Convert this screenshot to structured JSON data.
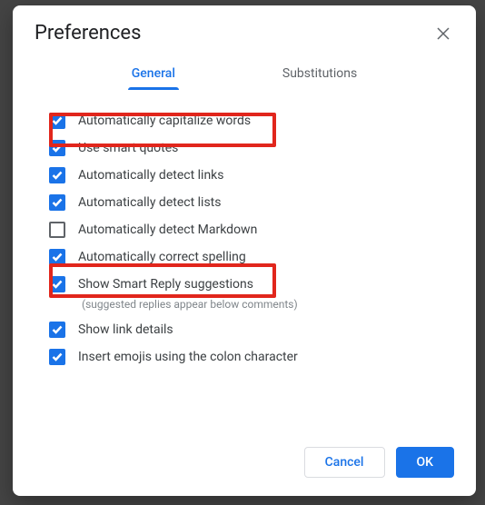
{
  "dialog": {
    "title": "Preferences"
  },
  "tabs": {
    "general": "General",
    "substitutions": "Substitutions",
    "active": "general"
  },
  "options": [
    {
      "label": "Automatically capitalize words",
      "checked": true
    },
    {
      "label": "Use smart quotes",
      "checked": true
    },
    {
      "label": "Automatically detect links",
      "checked": true
    },
    {
      "label": "Automatically detect lists",
      "checked": true
    },
    {
      "label": "Automatically detect Markdown",
      "checked": false
    },
    {
      "label": "Automatically correct spelling",
      "checked": true
    },
    {
      "label": "Show Smart Reply suggestions",
      "checked": true,
      "subtext": "(suggested replies appear below comments)"
    },
    {
      "label": "Show link details",
      "checked": true
    },
    {
      "label": "Insert emojis using the colon character",
      "checked": true
    }
  ],
  "buttons": {
    "cancel": "Cancel",
    "ok": "OK"
  }
}
